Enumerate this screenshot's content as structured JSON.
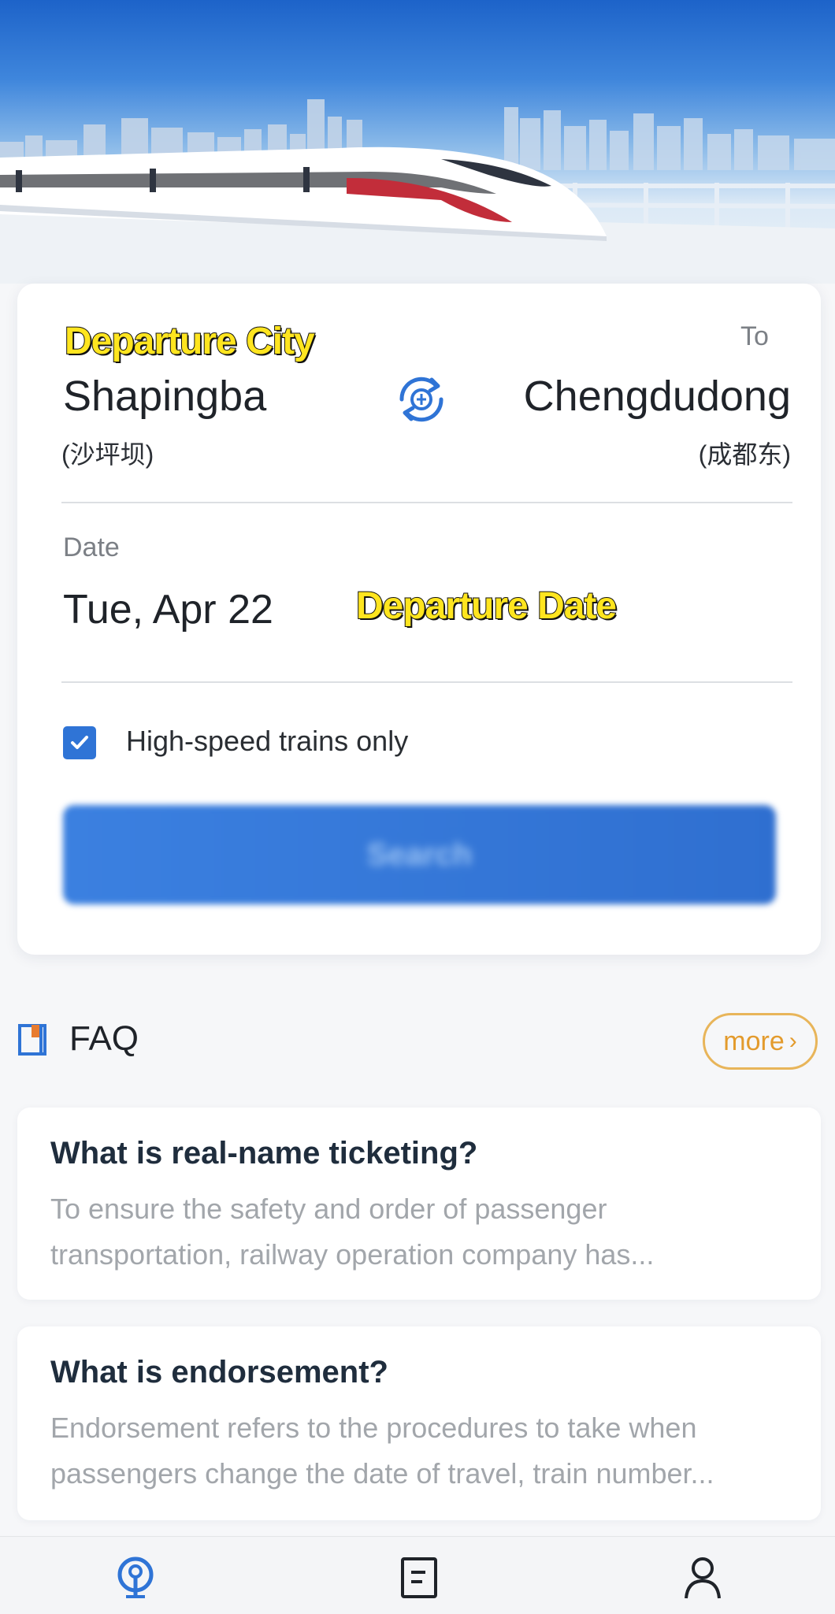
{
  "search": {
    "from_tag": "Departure City",
    "to_label": "To",
    "from_city": "Shapingba",
    "from_city_cn": "(沙坪坝)",
    "to_city": "Chengdudong",
    "to_city_cn": "(成都东)",
    "date_label": "Date",
    "date_value": "Tue, Apr 22",
    "date_tag": "Departure Date",
    "high_speed_label": "High-speed trains only",
    "high_speed_checked": true,
    "search_button": "Search"
  },
  "faq": {
    "title": "FAQ",
    "more_label": "more",
    "items": [
      {
        "question": "What is real-name ticketing?",
        "answer_line1": "To ensure the safety and order of passenger",
        "answer_line2": "transportation, railway operation company has..."
      },
      {
        "question": "What is endorsement?",
        "answer_line1": "Endorsement refers to the procedures to take when",
        "answer_line2": "passengers change the date of travel, train number..."
      }
    ]
  },
  "bottom_nav": {
    "items": [
      {
        "icon": "train-logo-icon",
        "active": true
      },
      {
        "icon": "orders-icon",
        "active": false
      },
      {
        "icon": "profile-icon",
        "active": false
      }
    ]
  },
  "colors": {
    "accent": "#2f74d6",
    "more": "#e39b2d",
    "overlay_tag": "#ffe51f"
  }
}
